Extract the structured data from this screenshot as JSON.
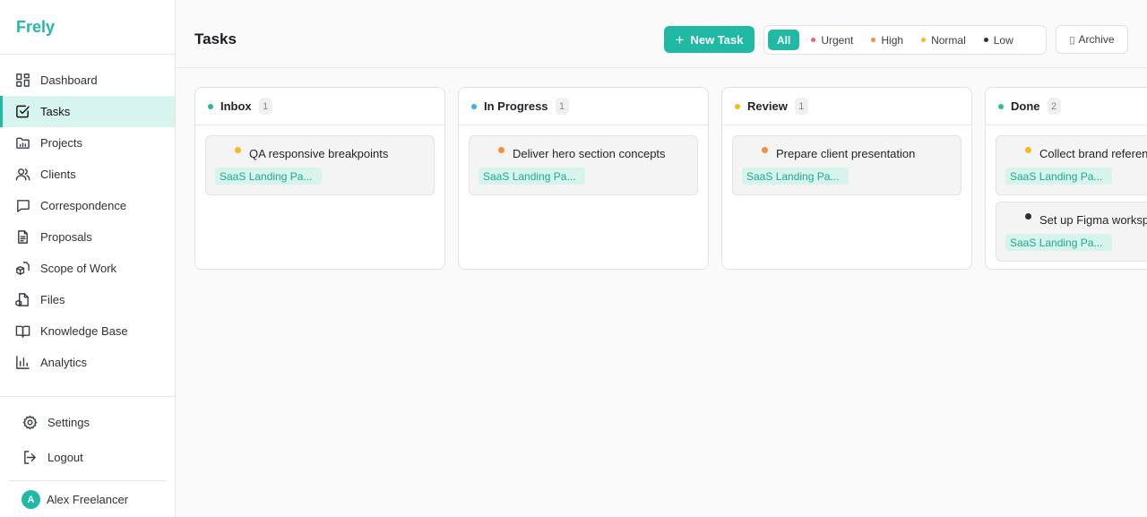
{
  "brand": "Frely",
  "nav": [
    {
      "label": "Dashboard",
      "icon": "dashboard-icon"
    },
    {
      "label": "Tasks",
      "icon": "tasks-icon",
      "active": true
    },
    {
      "label": "Projects",
      "icon": "folder-icon"
    },
    {
      "label": "Clients",
      "icon": "users-icon"
    },
    {
      "label": "Correspondence",
      "icon": "chat-icon"
    },
    {
      "label": "Proposals",
      "icon": "document-icon"
    },
    {
      "label": "Scope of Work",
      "icon": "cube-icon"
    },
    {
      "label": "Files",
      "icon": "file-icon"
    },
    {
      "label": "Knowledge Base",
      "icon": "book-icon"
    },
    {
      "label": "Analytics",
      "icon": "chart-icon"
    }
  ],
  "bottom": {
    "settings": "Settings",
    "logout": "Logout"
  },
  "user": {
    "initial": "A",
    "name": "Alex Freelancer"
  },
  "header": {
    "title": "Tasks",
    "new_task": "New Task",
    "filters": [
      {
        "label": "All",
        "active": true
      },
      {
        "label": "Urgent",
        "color": "#f06570"
      },
      {
        "label": "High",
        "color": "#f0913a"
      },
      {
        "label": "Normal",
        "color": "#f2bb1e"
      },
      {
        "label": "Low",
        "color": "#2d3136"
      }
    ],
    "archive": "Archive"
  },
  "colors": {
    "accent": "#1fb9a4"
  },
  "columns": [
    {
      "name": "Inbox",
      "color": "#1fb9a4",
      "count": "1",
      "cards": [
        {
          "title": "QA responsive breakpoints",
          "priority_color": "#f2bb1e",
          "tag": "SaaS Landing Pa..."
        }
      ]
    },
    {
      "name": "In Progress",
      "color": "#3ab0f0",
      "count": "1",
      "cards": [
        {
          "title": "Deliver hero section concepts",
          "priority_color": "#f0913a",
          "tag": "SaaS Landing Pa..."
        }
      ]
    },
    {
      "name": "Review",
      "color": "#f2bb1e",
      "count": "1",
      "cards": [
        {
          "title": "Prepare client presentation",
          "priority_color": "#f0913a",
          "tag": "SaaS Landing Pa..."
        }
      ]
    },
    {
      "name": "Done",
      "color": "#2fc28f",
      "count": "2",
      "cards": [
        {
          "title": "Collect brand references",
          "priority_color": "#f2bb1e",
          "tag": "SaaS Landing Pa..."
        },
        {
          "title": "Set up Figma workspace",
          "priority_color": "#2d3136",
          "tag": "SaaS Landing Pa..."
        }
      ]
    }
  ]
}
